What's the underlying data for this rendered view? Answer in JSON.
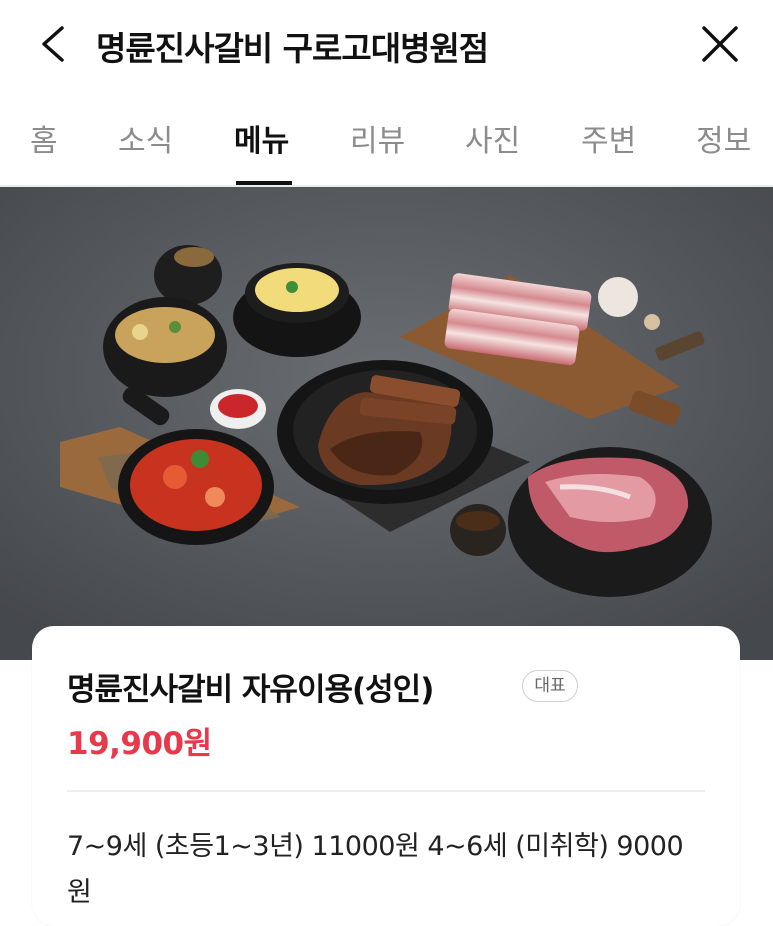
{
  "header": {
    "title": "명륜진사갈비 구로고대병원점",
    "back_icon": "chevron-left-icon",
    "close_icon": "close-icon"
  },
  "tabs": [
    {
      "label": "홈",
      "active": false
    },
    {
      "label": "소식",
      "active": false
    },
    {
      "label": "메뉴",
      "active": true
    },
    {
      "label": "리뷰",
      "active": false
    },
    {
      "label": "사진",
      "active": false
    },
    {
      "label": "주변",
      "active": false
    },
    {
      "label": "정보",
      "active": false
    }
  ],
  "menu_item": {
    "name": "명륜진사갈비 자유이용(성인)",
    "badge": "대표",
    "price": "19,900원",
    "description": "7~9세 (초등1~3년) 11000원 4~6세 (미취학) 9000원"
  },
  "colors": {
    "price_red": "#e7394b",
    "tab_active": "#111111",
    "tab_inactive": "#8c8c8c",
    "hero_background": "#55595e"
  }
}
